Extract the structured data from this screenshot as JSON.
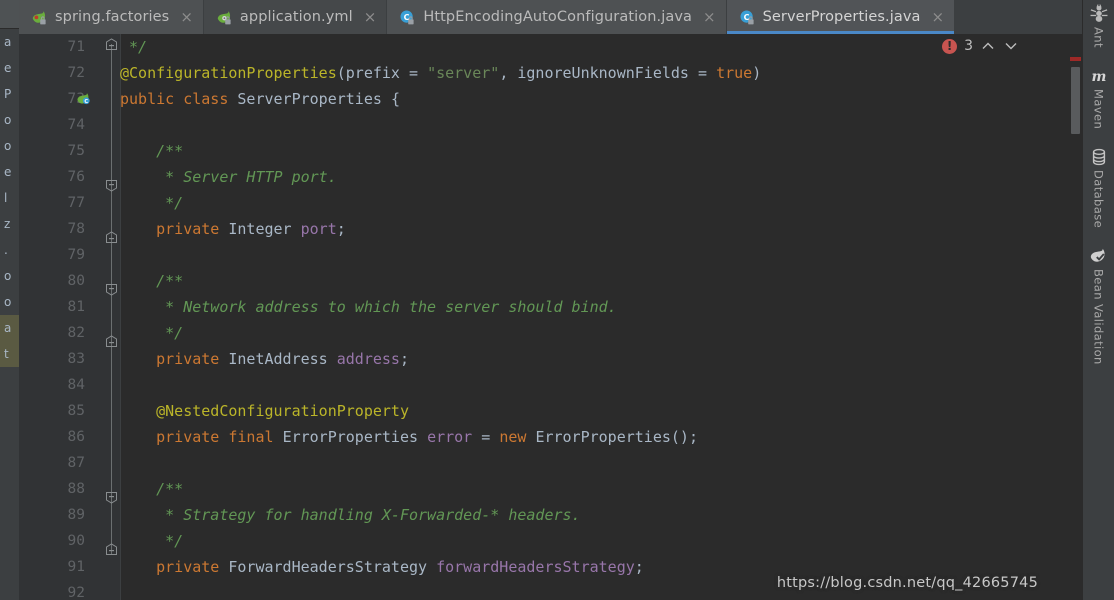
{
  "colors": {
    "editor_bg": "#2b2b2b",
    "gutter_bg": "#313335",
    "chrome_bg": "#3c3f41",
    "active_tab_underline": "#4a88c7",
    "keyword": "#cc7832",
    "annotation": "#bbb529",
    "comment": "#629755",
    "string": "#6a8759",
    "field": "#9876aa",
    "text": "#a9b7c6",
    "error_red": "#c75450"
  },
  "tabs": [
    {
      "label": "spring.factories",
      "icon": "spring-factories-icon",
      "state": "inactive"
    },
    {
      "label": "application.yml",
      "icon": "spring-yaml-icon",
      "state": "inactive"
    },
    {
      "label": "HttpEncodingAutoConfiguration.java",
      "icon": "java-class-icon",
      "state": "inactive"
    },
    {
      "label": "ServerProperties.java",
      "icon": "java-class-icon",
      "state": "active"
    }
  ],
  "tab_close_glyph": "×",
  "inspection_widget": {
    "error_icon": "error-icon",
    "error_glyph": "!",
    "error_count": "3",
    "prev_glyph": "prev-error-icon",
    "next_glyph": "next-error-icon"
  },
  "right_tool_window": [
    {
      "label": "Ant",
      "icon": "ant-icon"
    },
    {
      "label": "Maven",
      "icon": "maven-icon"
    },
    {
      "label": "Database",
      "icon": "database-icon"
    },
    {
      "label": "Bean Validation",
      "icon": "bean-validation-icon"
    }
  ],
  "left_strip_items": [
    "a",
    "e",
    "P",
    "o",
    "o",
    "e",
    "l",
    "z",
    ".",
    "o",
    "o",
    "a",
    "t"
  ],
  "editor": {
    "file": "ServerProperties.java",
    "first_line": 71,
    "gutter_icon_line": 73,
    "gutter_icon": "spring-bean-icon",
    "lines": [
      {
        "n": "71",
        "indent": 0,
        "tokens": [
          {
            "t": "cmt",
            "s": " */"
          }
        ]
      },
      {
        "n": "72",
        "indent": 0,
        "tokens": [
          {
            "t": "anno",
            "s": "@ConfigurationProperties"
          },
          {
            "t": "plain",
            "s": "(prefix = "
          },
          {
            "t": "str",
            "s": "\"server\""
          },
          {
            "t": "plain",
            "s": ", ignoreUnknownFields = "
          },
          {
            "t": "kw",
            "s": "true"
          },
          {
            "t": "plain",
            "s": ")"
          }
        ]
      },
      {
        "n": "73",
        "indent": 0,
        "tokens": [
          {
            "t": "kw",
            "s": "public class "
          },
          {
            "t": "type",
            "s": "ServerProperties "
          },
          {
            "t": "plain",
            "s": "{"
          }
        ]
      },
      {
        "n": "74",
        "indent": 0,
        "tokens": []
      },
      {
        "n": "75",
        "indent": 1,
        "tokens": [
          {
            "t": "cmt",
            "s": "/**"
          }
        ]
      },
      {
        "n": "76",
        "indent": 1,
        "tokens": [
          {
            "t": "cmt",
            "s": " * Server HTTP port."
          }
        ]
      },
      {
        "n": "77",
        "indent": 1,
        "tokens": [
          {
            "t": "cmt",
            "s": " */"
          }
        ]
      },
      {
        "n": "78",
        "indent": 1,
        "tokens": [
          {
            "t": "kw",
            "s": "private "
          },
          {
            "t": "type",
            "s": "Integer "
          },
          {
            "t": "field",
            "s": "port"
          },
          {
            "t": "plain",
            "s": ";"
          }
        ]
      },
      {
        "n": "79",
        "indent": 0,
        "tokens": []
      },
      {
        "n": "80",
        "indent": 1,
        "tokens": [
          {
            "t": "cmt",
            "s": "/**"
          }
        ]
      },
      {
        "n": "81",
        "indent": 1,
        "tokens": [
          {
            "t": "cmt",
            "s": " * Network address to which the server should bind."
          }
        ]
      },
      {
        "n": "82",
        "indent": 1,
        "tokens": [
          {
            "t": "cmt",
            "s": " */"
          }
        ]
      },
      {
        "n": "83",
        "indent": 1,
        "tokens": [
          {
            "t": "kw",
            "s": "private "
          },
          {
            "t": "type",
            "s": "InetAddress "
          },
          {
            "t": "field",
            "s": "address"
          },
          {
            "t": "plain",
            "s": ";"
          }
        ]
      },
      {
        "n": "84",
        "indent": 0,
        "tokens": []
      },
      {
        "n": "85",
        "indent": 1,
        "tokens": [
          {
            "t": "anno",
            "s": "@NestedConfigurationProperty"
          }
        ]
      },
      {
        "n": "86",
        "indent": 1,
        "tokens": [
          {
            "t": "kw",
            "s": "private final "
          },
          {
            "t": "type",
            "s": "ErrorProperties "
          },
          {
            "t": "field",
            "s": "error "
          },
          {
            "t": "plain",
            "s": "= "
          },
          {
            "t": "kw",
            "s": "new "
          },
          {
            "t": "type",
            "s": "ErrorProperties"
          },
          {
            "t": "plain",
            "s": "();"
          }
        ]
      },
      {
        "n": "87",
        "indent": 0,
        "tokens": []
      },
      {
        "n": "88",
        "indent": 1,
        "tokens": [
          {
            "t": "cmt",
            "s": "/**"
          }
        ]
      },
      {
        "n": "89",
        "indent": 1,
        "tokens": [
          {
            "t": "cmt",
            "s": " * Strategy for handling X-Forwarded-* headers."
          }
        ]
      },
      {
        "n": "90",
        "indent": 1,
        "tokens": [
          {
            "t": "cmt",
            "s": " */"
          }
        ]
      },
      {
        "n": "91",
        "indent": 1,
        "tokens": [
          {
            "t": "kw",
            "s": "private "
          },
          {
            "t": "type",
            "s": "ForwardHeadersStrategy "
          },
          {
            "t": "field",
            "s": "forwardHeadersStrategy"
          },
          {
            "t": "plain",
            "s": ";"
          }
        ]
      },
      {
        "n": "92",
        "indent": 0,
        "tokens": []
      }
    ]
  },
  "watermark": {
    "text": "https://blog.csdn.net/qq_42665745"
  }
}
